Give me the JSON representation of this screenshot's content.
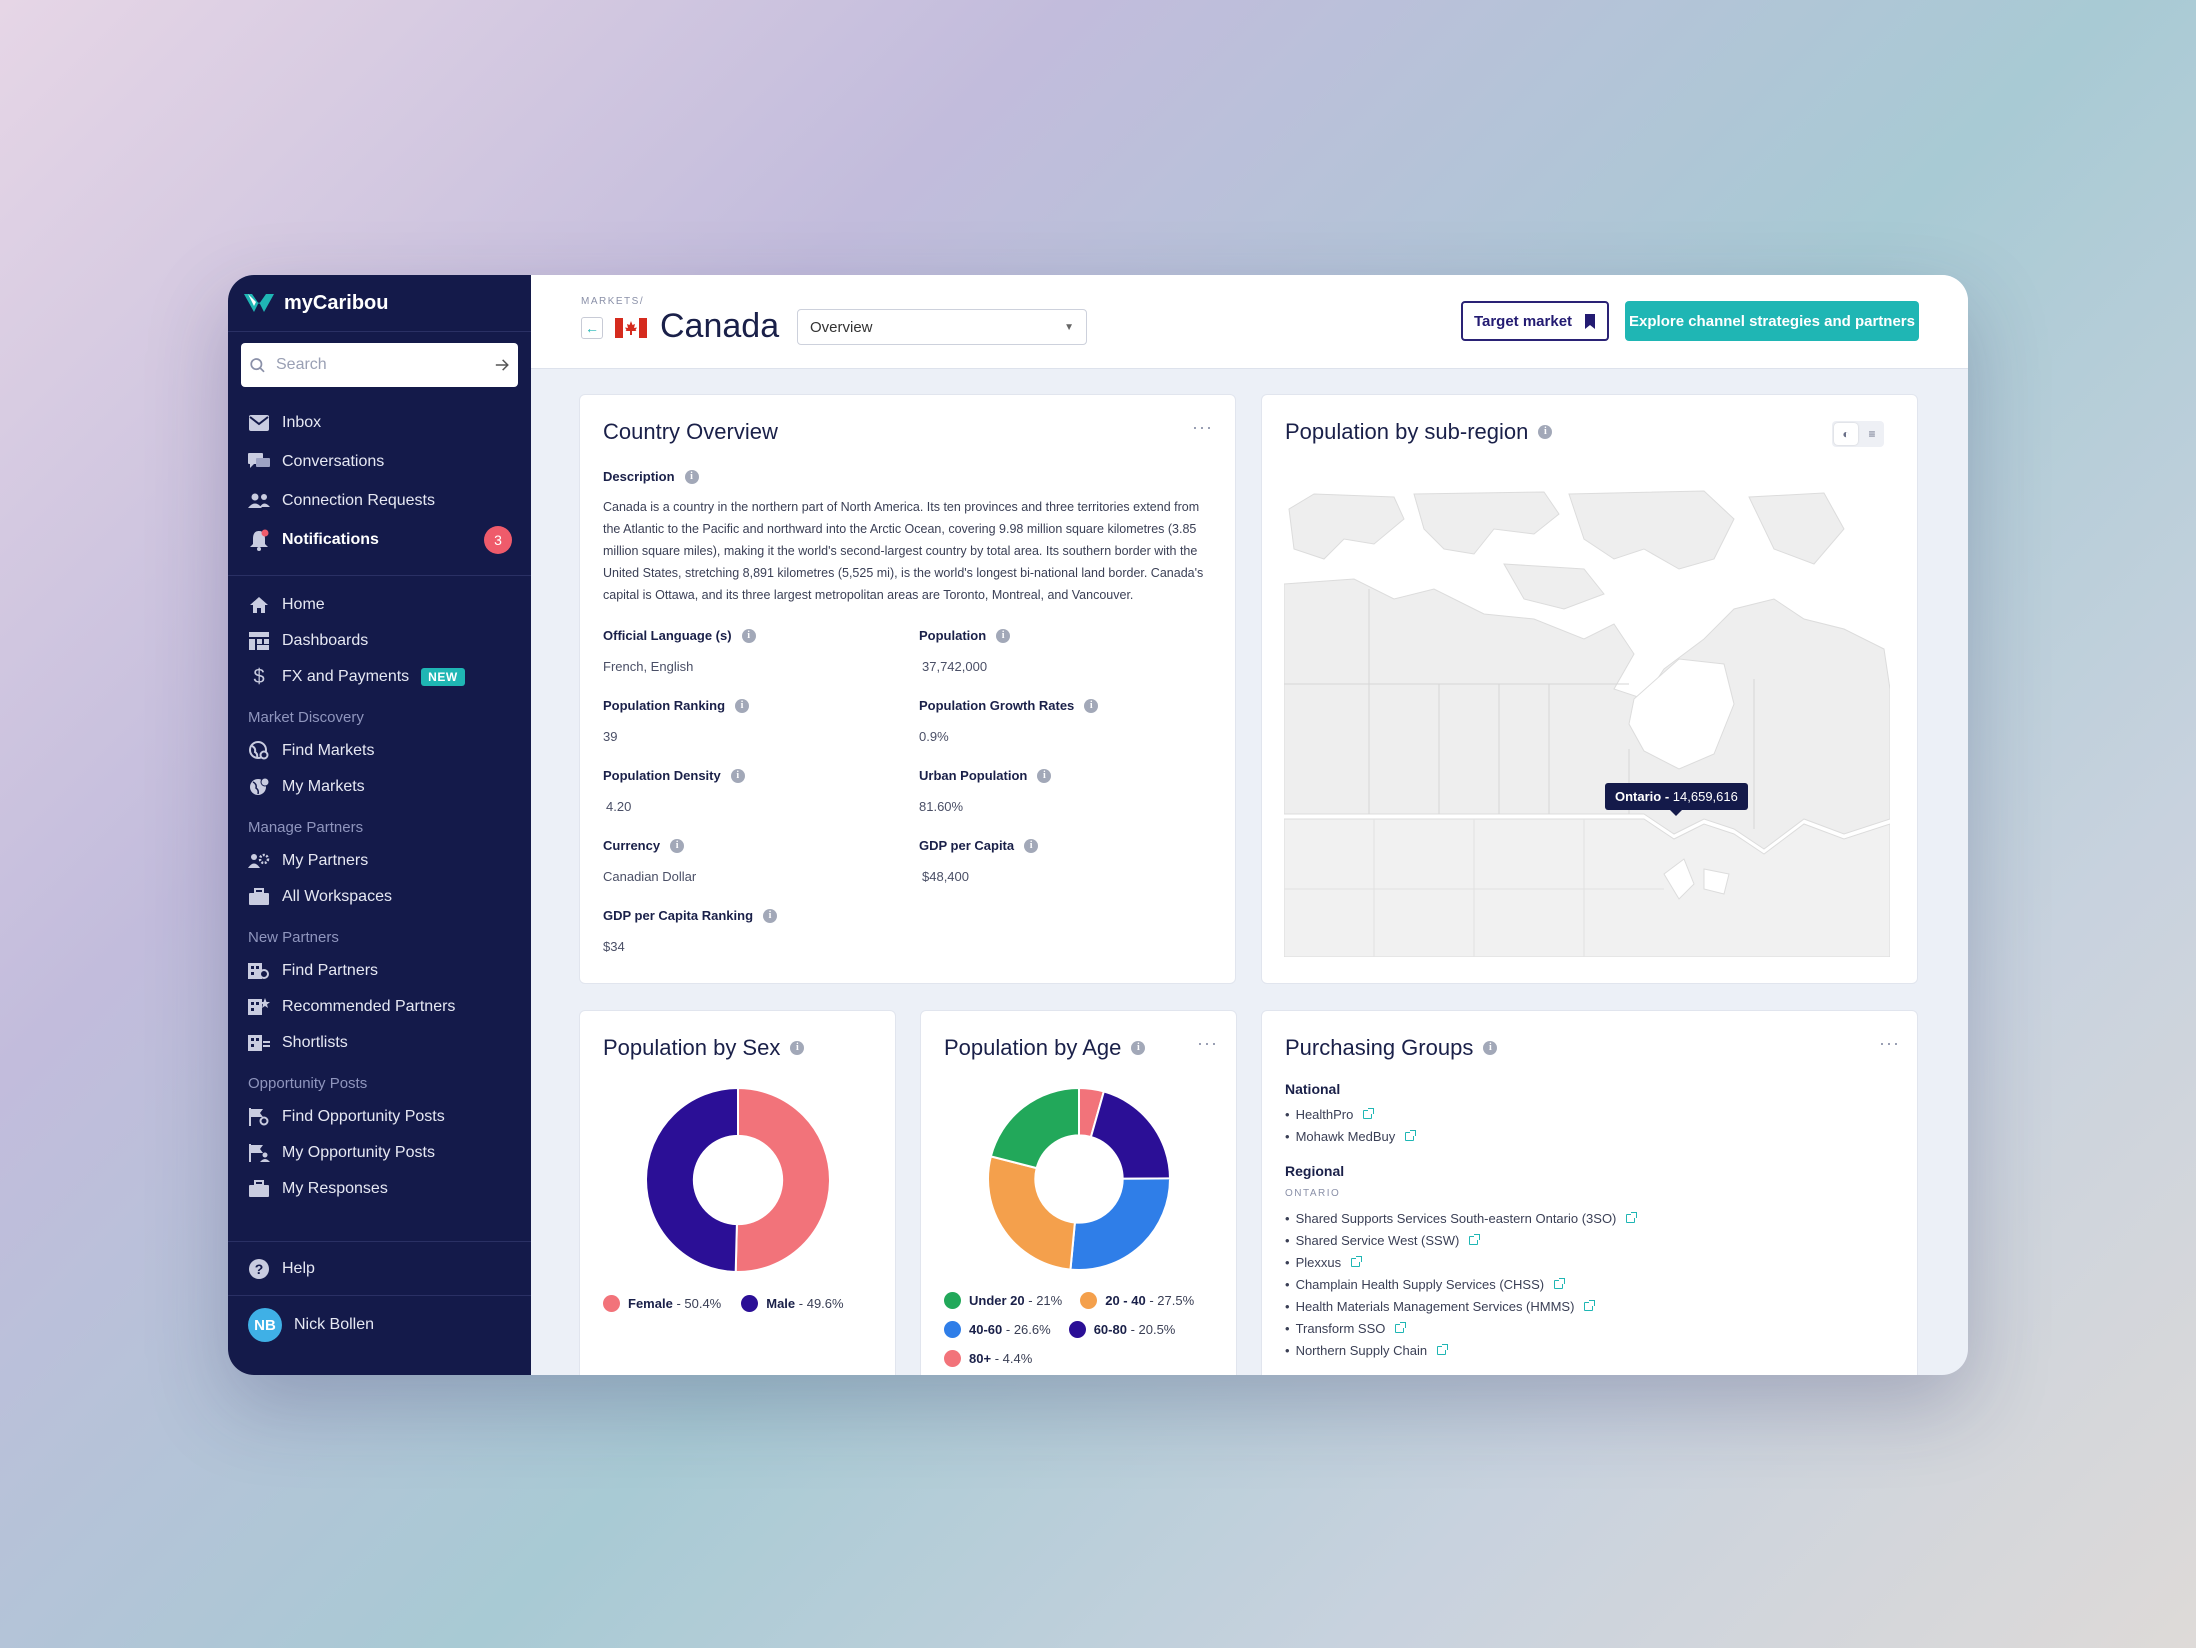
{
  "app": {
    "name": "myCaribou"
  },
  "search": {
    "placeholder": "Search"
  },
  "nav": {
    "inbox": "Inbox",
    "conversations": "Conversations",
    "connection_requests": "Connection Requests",
    "notifications": "Notifications",
    "notifications_count": "3",
    "home": "Home",
    "dashboards": "Dashboards",
    "fx": "FX and Payments",
    "fx_badge": "NEW",
    "market_discovery": "Market Discovery",
    "find_markets": "Find Markets",
    "my_markets": "My Markets",
    "manage_partners": "Manage Partners",
    "my_partners": "My Partners",
    "all_workspaces": "All Workspaces",
    "new_partners": "New Partners",
    "find_partners": "Find Partners",
    "recommended_partners": "Recommended Partners",
    "shortlists": "Shortlists",
    "opportunity_posts": "Opportunity Posts",
    "find_opportunity_posts": "Find Opportunity Posts",
    "my_opportunity_posts": "My Opportunity Posts",
    "my_responses": "My Responses",
    "help": "Help"
  },
  "user": {
    "initials": "NB",
    "name": "Nick Bollen"
  },
  "header": {
    "breadcrumb": "MARKETS/",
    "title": "Canada",
    "view_select": "Overview",
    "target_market": "Target market",
    "explore": "Explore channel strategies and partners"
  },
  "overview": {
    "title": "Country Overview",
    "description_label": "Description",
    "description": "Canada is a country in the northern part of North America. Its ten provinces and three territories extend from the Atlantic to the Pacific and northward into the Arctic Ocean, covering 9.98 million square kilometres (3.85 million square miles), making it the world's second-largest country by total area. Its southern border with the United States, stretching 8,891 kilometres (5,525 mi), is the world's longest bi-national land border. Canada's capital is Ottawa, and its three largest metropolitan areas are Toronto, Montreal, and Vancouver.",
    "fields": [
      {
        "label": "Official Language (s)",
        "value": "French, English"
      },
      {
        "label": "Population",
        "value": "37,742,000"
      },
      {
        "label": "Population Ranking",
        "value": "39"
      },
      {
        "label": "Population Growth Rates",
        "value": "0.9%"
      },
      {
        "label": "Population Density",
        "value": "4.20"
      },
      {
        "label": "Urban Population",
        "value": "81.60%"
      },
      {
        "label": "Currency",
        "value": "Canadian Dollar"
      },
      {
        "label": "GDP per Capita",
        "value": "$48,400"
      },
      {
        "label": "GDP per Capita Ranking",
        "value": "$34"
      }
    ]
  },
  "map": {
    "title": "Population by sub-region",
    "tooltip_region": "Ontario -",
    "tooltip_value": "14,659,616"
  },
  "sex": {
    "title": "Population by Sex",
    "slices": [
      {
        "label": "Female",
        "text": "- 50.4%",
        "value": 50.4,
        "color": "#f2737a"
      },
      {
        "label": "Male",
        "text": "- 49.6%",
        "value": 49.6,
        "color": "#2b0f96"
      }
    ]
  },
  "age": {
    "title": "Population by Age",
    "slices": [
      {
        "label": "Under 20",
        "text": "- 21%",
        "value": 21,
        "color": "#22a85a"
      },
      {
        "label": "20 - 40",
        "text": "- 27.5%",
        "value": 27.5,
        "color": "#f4a04c"
      },
      {
        "label": "40-60",
        "text": "- 26.6%",
        "value": 26.6,
        "color": "#2f7ee8"
      },
      {
        "label": "60-80",
        "text": "- 20.5%",
        "value": 20.5,
        "color": "#2b0f96"
      },
      {
        "label": "80+",
        "text": "- 4.4%",
        "value": 4.4,
        "color": "#f2737a"
      }
    ]
  },
  "purchasing": {
    "title": "Purchasing Groups",
    "national_label": "National",
    "national": [
      "HealthPro",
      "Mohawk MedBuy"
    ],
    "regional_label": "Regional",
    "region": "ONTARIO",
    "regional": [
      "Shared Supports Services South-eastern Ontario (3SO)",
      "Shared Service West (SSW)",
      "Plexxus",
      "Champlain Health Supply Services (CHSS)",
      "Health Materials Management Services (HMMS)",
      "Transform SSO",
      "Northern Supply Chain"
    ]
  },
  "colors": {
    "brand_navy": "#141a4a",
    "accent_teal": "#1fb6b4",
    "alert_red": "#ef5b6b"
  }
}
